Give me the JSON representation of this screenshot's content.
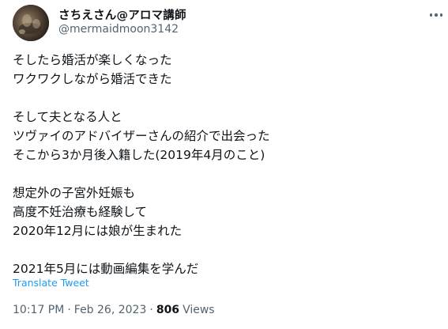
{
  "tweet": {
    "author": {
      "display_name": "さちえさん@アロマ講師",
      "handle": "@mermaidmoon3142"
    },
    "more_icon": "more-horizontal-icon",
    "body_lines": [
      "そしたら婚活が楽しくなった",
      "ワクワクしながら婚活できた",
      "",
      "そして夫となる人と",
      "ツヴァイのアドバイザーさんの紹介で出会った",
      "そこから3か月後入籍した(2019年4月のこと)",
      "",
      "想定外の子宮外妊娠も",
      "高度不妊治療も経験して",
      "2020年12月には娘が生まれた",
      "",
      "2021年5月には動画編集を学んだ"
    ],
    "translate_label": "Translate Tweet",
    "time": "10:17 PM",
    "date": "Feb 26, 2023",
    "separator": "·",
    "views_count": "806",
    "views_label": "Views",
    "link_color": "#1d9bf0",
    "secondary_text_color": "#536471"
  }
}
